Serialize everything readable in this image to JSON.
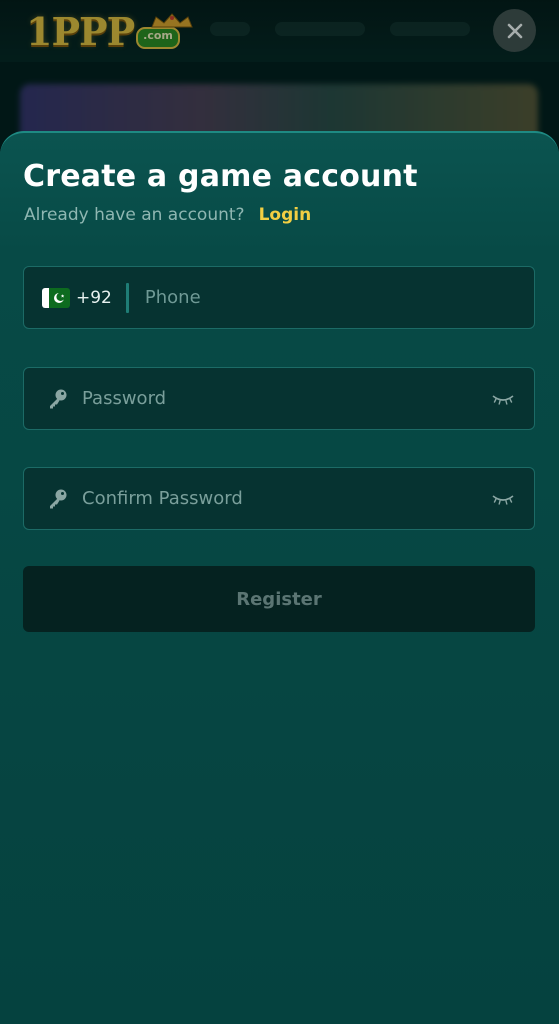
{
  "header": {
    "logo_text": "1PPP",
    "logo_badge": ".com",
    "close_icon": "close-icon"
  },
  "form": {
    "title": "Create a game account",
    "subtitle": "Already have an account?",
    "login_link": "Login",
    "phone": {
      "country_code": "+92",
      "flag_icon": "pakistan-flag-icon",
      "placeholder": "Phone",
      "value": ""
    },
    "password": {
      "icon": "key-icon",
      "placeholder": "Password",
      "visibility_icon": "eye-closed-icon",
      "value": ""
    },
    "confirm_password": {
      "icon": "key-icon",
      "placeholder": "Confirm Password",
      "visibility_icon": "eye-closed-icon",
      "value": ""
    },
    "register_label": "Register"
  },
  "colors": {
    "accent": "#f2cf43",
    "sheet_background": "#074a46",
    "field_background": "#063331",
    "register_background": "#052220"
  }
}
